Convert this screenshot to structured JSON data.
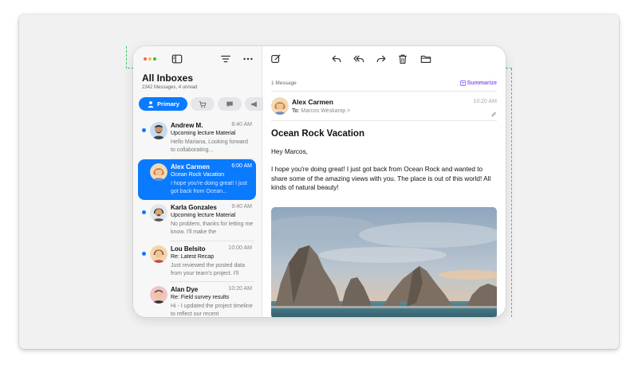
{
  "window": {
    "toolbar": {
      "traffic_lights": [
        "#ff5f57",
        "#febc2e",
        "#28c840"
      ],
      "icons": [
        "sidebar-toggle-icon",
        "filter-icon",
        "more-icon",
        "compose-icon",
        "reply-icon",
        "reply-all-icon",
        "forward-icon",
        "trash-icon",
        "folder-icon",
        "more-icon",
        "search-icon"
      ]
    },
    "sidebar": {
      "title": "All Inboxes",
      "subtitle": "2342 Messages, 4 unread",
      "chips": [
        {
          "label": "Primary",
          "icon": "person-icon",
          "active": true
        },
        {
          "label": "",
          "icon": "cart-icon",
          "active": false
        },
        {
          "label": "",
          "icon": "chat-icon",
          "active": false
        },
        {
          "label": "",
          "icon": "megaphone-icon",
          "active": false
        }
      ],
      "messages": [
        {
          "sender": "Andrew M.",
          "time": "8:40 AM",
          "subject": "Upcoming lecture Material",
          "preview": "Hello Mariana, Looking forward to collaborating...",
          "unread": true,
          "selected": false
        },
        {
          "sender": "Alex Carmen",
          "time": "6:00 AM",
          "subject": "Ocean Rock Vacation",
          "preview": "I hope you're doing great! I just got back from Ocean...",
          "unread": false,
          "selected": true
        },
        {
          "sender": "Karla Gonzales",
          "time": "9:40 AM",
          "subject": "Upcoming lecture Material",
          "preview": "No problem, thanks for letting me know. I'll make the",
          "unread": true,
          "selected": false
        },
        {
          "sender": "Lou Belsito",
          "time": "10:00 AM",
          "subject": "Re: Latest Recap",
          "preview": "Just reviewed the posted data from your team's project. I'll",
          "unread": true,
          "selected": false
        },
        {
          "sender": "Alan Dye",
          "time": "10:20 AM",
          "subject": "Re: Field survey results",
          "preview": "Hi - I updated the project timeline to reflect our recent",
          "unread": false,
          "selected": false
        }
      ]
    },
    "detail": {
      "message_count": "1 Message",
      "summarize_label": "Summarize",
      "from": "Alex Carmen",
      "to_label": "To:",
      "to_name": "Marcos Weskamp",
      "to_chevron": ">",
      "time": "10:20 AM",
      "subject": "Ocean Rock Vacation",
      "greeting": "Hey Marcos,",
      "body": "I hope you're doing great! I just got back from Ocean Rock and wanted to share some of the amazing views with you. The place is out of this world! All kinds of natural beauty!"
    }
  },
  "colors": {
    "accent": "#0a7aff",
    "summarize": "#8a5cf6",
    "guides": "#3ec86e"
  }
}
